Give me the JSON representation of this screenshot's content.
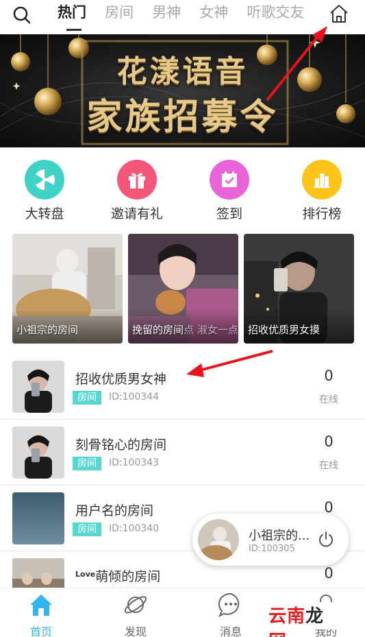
{
  "tabs": [
    "热门",
    "房间",
    "男神",
    "女神",
    "听歌交友"
  ],
  "banner": {
    "line1": "花漾语音",
    "line2": "家族招募令"
  },
  "quick_actions": [
    {
      "label": "大转盘",
      "icon": "wheel-icon",
      "color": "#3fd3c6"
    },
    {
      "label": "邀请有礼",
      "icon": "gift-icon",
      "color": "#f5577a"
    },
    {
      "label": "签到",
      "icon": "calendar-check-icon",
      "color": "#e765d8"
    },
    {
      "label": "排行榜",
      "icon": "bar-chart-icon",
      "color": "#ffc41a"
    }
  ],
  "cards": [
    {
      "label": "小祖宗的房间"
    },
    {
      "label": "挽留的房间",
      "overlay": "点 淑女一点"
    },
    {
      "label": "招收优质男女摸"
    }
  ],
  "rooms": [
    {
      "title": "招收优质男女神",
      "tag": "房间",
      "id": "ID:100344",
      "count": "0",
      "status": "在线"
    },
    {
      "title": "刻骨铭心的房间",
      "tag": "房间",
      "id": "ID:100343",
      "count": "0",
      "status": "在线"
    },
    {
      "title": "用户名的房间",
      "tag": "房间",
      "id": "ID:100340",
      "count": "0",
      "status": ""
    },
    {
      "title_prefix": "Love",
      "title": "萌倾的房间",
      "count": "0"
    }
  ],
  "mini_player": {
    "name": "小祖宗的...",
    "id": "ID:100305"
  },
  "bottom_nav": [
    {
      "label": "首页",
      "icon": "home-icon"
    },
    {
      "label": "发现",
      "icon": "planet-icon"
    },
    {
      "label": "消息",
      "icon": "chat-icon"
    },
    {
      "label": "我的",
      "icon": "user-icon"
    }
  ],
  "watermark": {
    "part1": "云南",
    "part2": "龙",
    "part3": "网"
  },
  "colors": {
    "accent": "#33b5f0",
    "tag": "#5ad6d0",
    "arrow": "#e8141b"
  }
}
